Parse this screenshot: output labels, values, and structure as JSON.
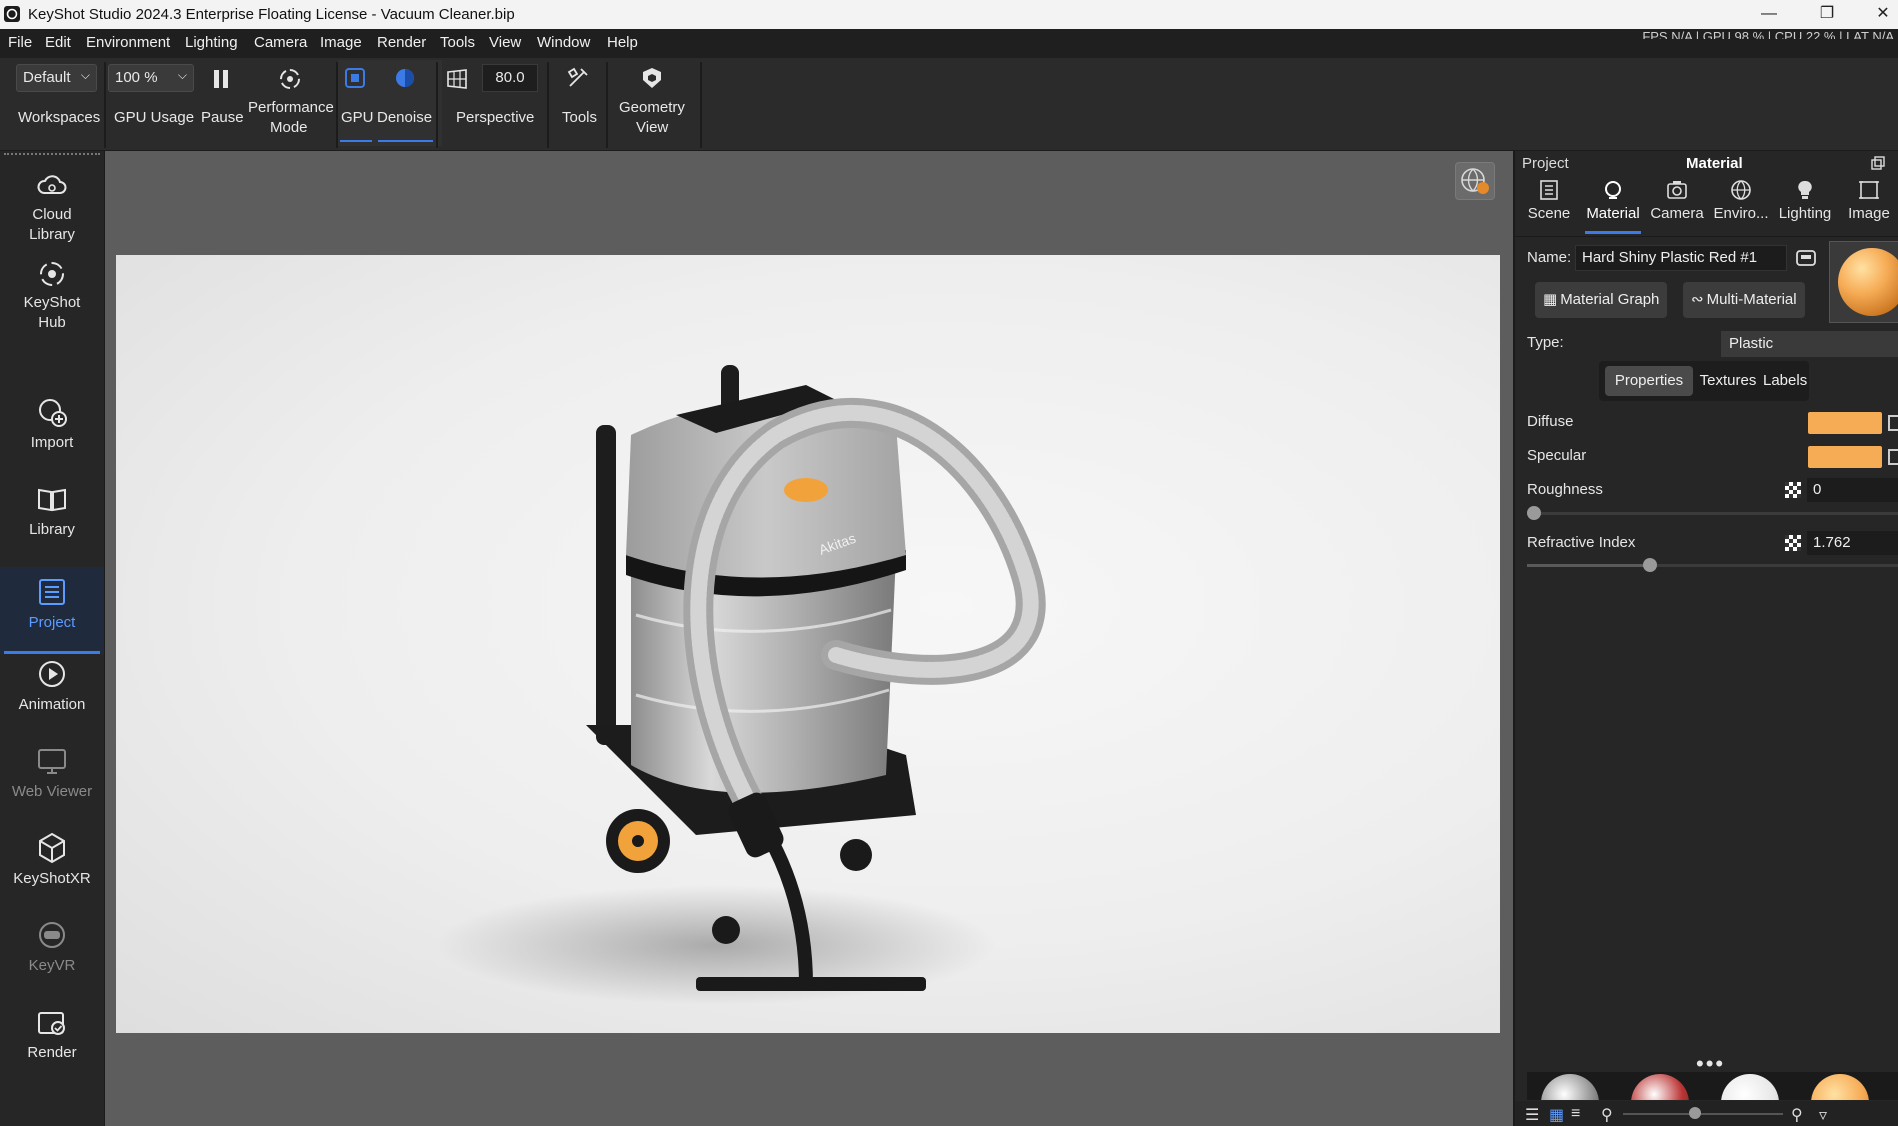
{
  "window": {
    "title": "KeyShot Studio 2024.3 Enterprise Floating License  - Vacuum Cleaner.bip",
    "minimize": "—",
    "maximize": "❐",
    "close": "✕"
  },
  "menu": [
    "File",
    "Edit",
    "Environment",
    "Lighting",
    "Camera",
    "Image",
    "Render",
    "Tools",
    "View",
    "Window",
    "Help"
  ],
  "status": "FPS N/A  |  GPU 98 %  |  CPU 22 %  |  LAT N/A",
  "toolbar": {
    "workspace_value": "Default",
    "workspaces_label": "Workspaces",
    "gpu_usage_value": "100 %",
    "gpu_usage_label": "GPU Usage",
    "pause_label": "Pause",
    "performance_label_1": "Performance",
    "performance_label_2": "Mode",
    "gpu_label": "GPU",
    "denoise_label": "Denoise",
    "fov_value": "80.0",
    "perspective_label": "Perspective",
    "tools_label": "Tools",
    "geometry_label_1": "Geometry",
    "geometry_label_2": "View"
  },
  "sidebar": [
    {
      "l1": "Cloud",
      "l2": "Library",
      "icon": "cloud-library-icon"
    },
    {
      "l1": "KeyShot",
      "l2": "Hub",
      "icon": "keyshot-hub-icon"
    },
    {
      "l1": "Import",
      "icon": "import-icon"
    },
    {
      "l1": "Library",
      "icon": "library-icon"
    },
    {
      "l1": "Project",
      "icon": "project-icon",
      "active": true
    },
    {
      "l1": "Animation",
      "icon": "animation-icon"
    },
    {
      "l1": "Web Viewer",
      "icon": "web-viewer-icon",
      "dim": true
    },
    {
      "l1": "KeyShotXR",
      "icon": "keyshotxr-icon"
    },
    {
      "l1": "KeyVR",
      "icon": "keyvr-icon",
      "dim": true
    },
    {
      "l1": "Render",
      "icon": "render-icon"
    }
  ],
  "render": {
    "brand_text": "Akitas"
  },
  "panel": {
    "project_label": "Project",
    "section_title": "Material",
    "tabs": [
      "Scene",
      "Material",
      "Camera",
      "Enviro...",
      "Lighting",
      "Image"
    ],
    "name_label": "Name:",
    "name_value": "Hard Shiny Plastic Red #1",
    "material_graph": "Material Graph",
    "multi_material": "Multi-Material",
    "type_label": "Type:",
    "type_value": "Plastic",
    "subtabs": [
      "Properties",
      "Textures",
      "Labels"
    ],
    "diffuse_label": "Diffuse",
    "specular_label": "Specular",
    "roughness_label": "Roughness",
    "roughness_value": "0",
    "roughness_fraction": 0.0,
    "refractive_label": "Refractive Index",
    "refractive_value": "1.762",
    "refractive_fraction": 0.33,
    "more": "•••",
    "colors": {
      "diffuse": "#f6ab55",
      "specular": "#f6ab55",
      "accent": "#3b7be8"
    }
  }
}
